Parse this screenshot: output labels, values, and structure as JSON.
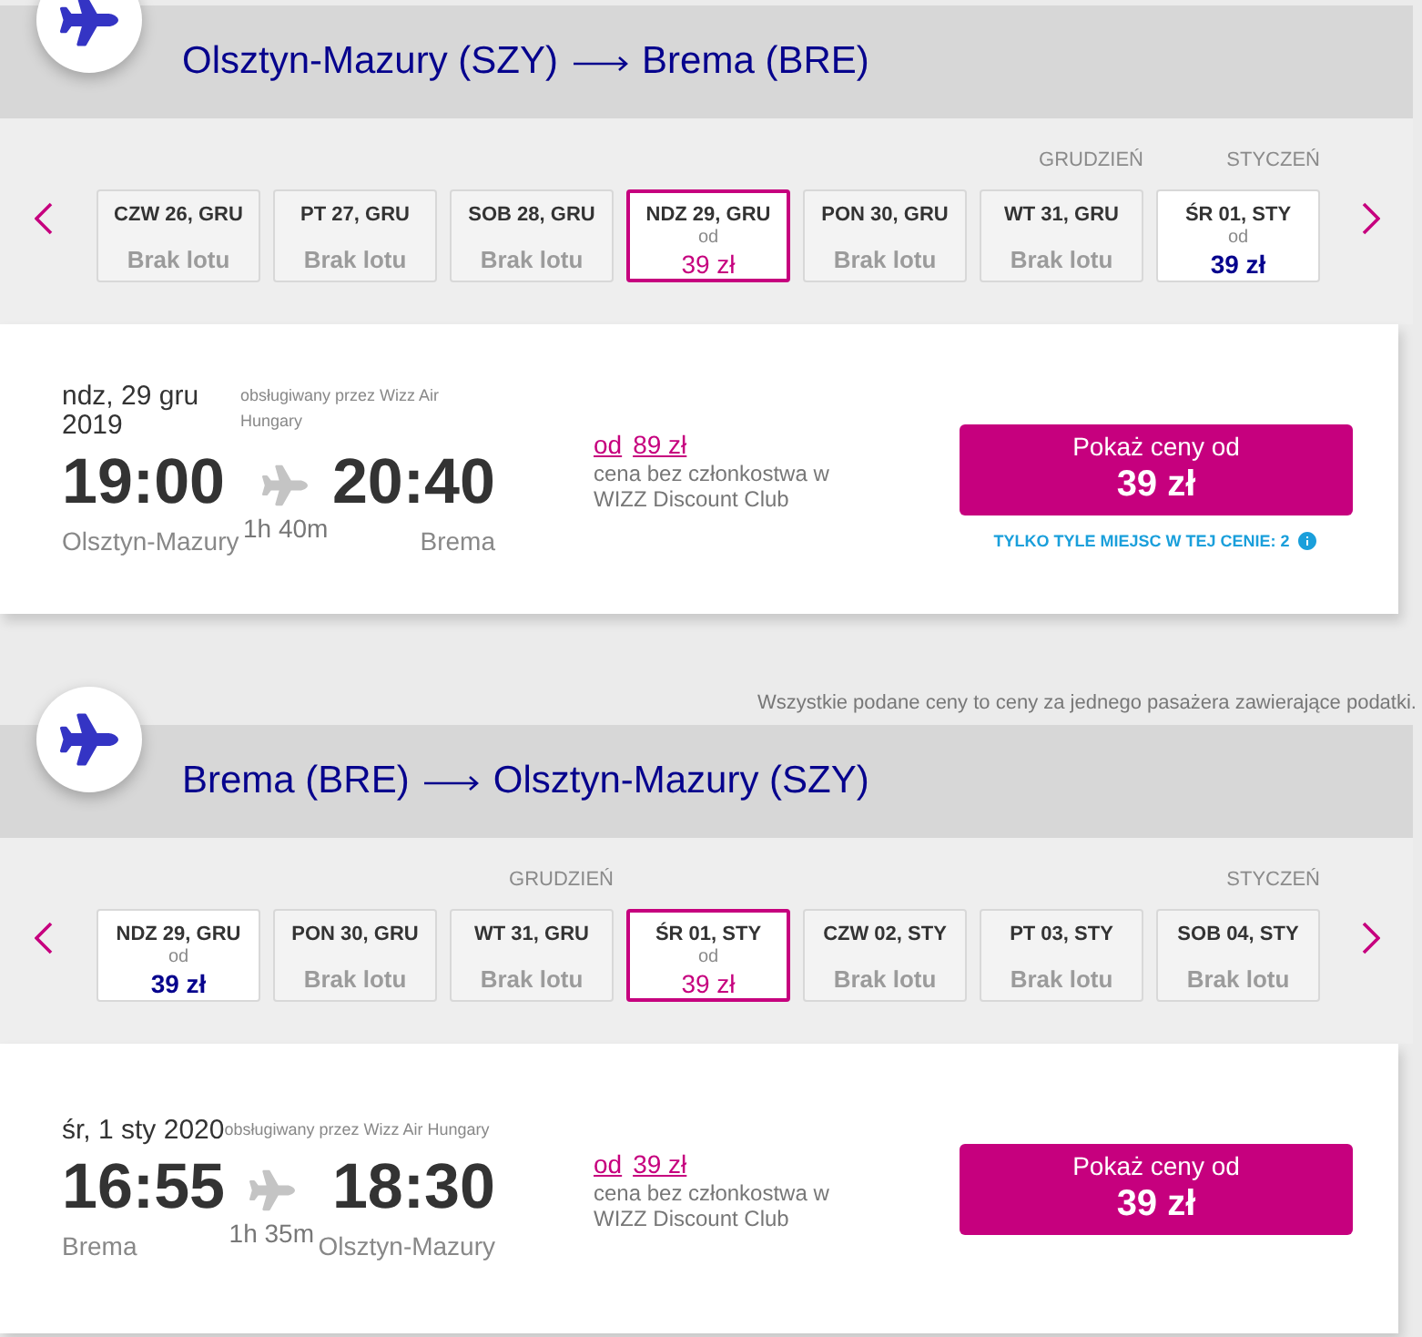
{
  "outbound": {
    "route": {
      "origin": "Olsztyn-Mazury (SZY)",
      "destination": "Brema (BRE)"
    },
    "dates": [
      {
        "kind": "no_flight",
        "day": "CZW 26, GRU",
        "status": "Brak lotu",
        "selected": false
      },
      {
        "kind": "no_flight",
        "day": "PT 27, GRU",
        "status": "Brak lotu",
        "selected": false
      },
      {
        "kind": "no_flight",
        "day": "SOB 28, GRU",
        "status": "Brak lotu",
        "selected": false
      },
      {
        "kind": "fare",
        "day": "NDZ 29, GRU",
        "prefix": "od",
        "price": "39 zł",
        "selected": true
      },
      {
        "kind": "no_flight",
        "day": "PON 30, GRU",
        "status": "Brak lotu",
        "selected": false
      },
      {
        "kind": "no_flight",
        "day": "WT 31, GRU",
        "status": "Brak lotu",
        "selected": false,
        "month": "GRUDZIEŃ"
      },
      {
        "kind": "fare",
        "day": "ŚR 01, STY",
        "prefix": "od",
        "price": "39 zł",
        "selected": false,
        "month": "STYCZEŃ"
      }
    ],
    "flight": {
      "date": "ndz, 29 gru 2019",
      "operator": "obsługiwany przez Wizz Air Hungary",
      "departure_time": "19:00",
      "arrival_time": "20:40",
      "duration": "1h 40m",
      "departure_city": "Olsztyn-Mazury",
      "arrival_city": "Brema",
      "member_price": {
        "prefix": "od",
        "price": "89 zł",
        "note": "cena bez członkostwa w WIZZ Discount Club"
      },
      "button": {
        "label": "Pokaż ceny od",
        "price": "39 zł"
      },
      "seats_warning": "TYLKO TYLE MIEJSC W TEJ CENIE: 2"
    }
  },
  "price_note": "Wszystkie podane ceny to ceny za jednego pasażera zawierające podatki.",
  "return": {
    "route": {
      "origin": "Brema (BRE)",
      "destination": "Olsztyn-Mazury (SZY)"
    },
    "dates": [
      {
        "kind": "fare",
        "day": "NDZ 29, GRU",
        "prefix": "od",
        "price": "39 zł",
        "selected": false
      },
      {
        "kind": "no_flight",
        "day": "PON 30, GRU",
        "status": "Brak lotu",
        "selected": false
      },
      {
        "kind": "no_flight",
        "day": "WT 31, GRU",
        "status": "Brak lotu",
        "selected": false,
        "month": "GRUDZIEŃ"
      },
      {
        "kind": "fare",
        "day": "ŚR 01, STY",
        "prefix": "od",
        "price": "39 zł",
        "selected": true
      },
      {
        "kind": "no_flight",
        "day": "CZW 02, STY",
        "status": "Brak lotu",
        "selected": false
      },
      {
        "kind": "no_flight",
        "day": "PT 03, STY",
        "status": "Brak lotu",
        "selected": false
      },
      {
        "kind": "no_flight",
        "day": "SOB 04, STY",
        "status": "Brak lotu",
        "selected": false,
        "month": "STYCZEŃ"
      }
    ],
    "flight": {
      "date": "śr, 1 sty 2020",
      "operator": "obsługiwany przez Wizz Air Hungary",
      "departure_time": "16:55",
      "arrival_time": "18:30",
      "duration": "1h 35m",
      "departure_city": "Brema",
      "arrival_city": "Olsztyn-Mazury",
      "member_price": {
        "prefix": "od",
        "price": "39 zł",
        "note": "cena bez członkostwa w WIZZ Discount Club"
      },
      "button": {
        "label": "Pokaż ceny od",
        "price": "39 zł"
      }
    }
  }
}
